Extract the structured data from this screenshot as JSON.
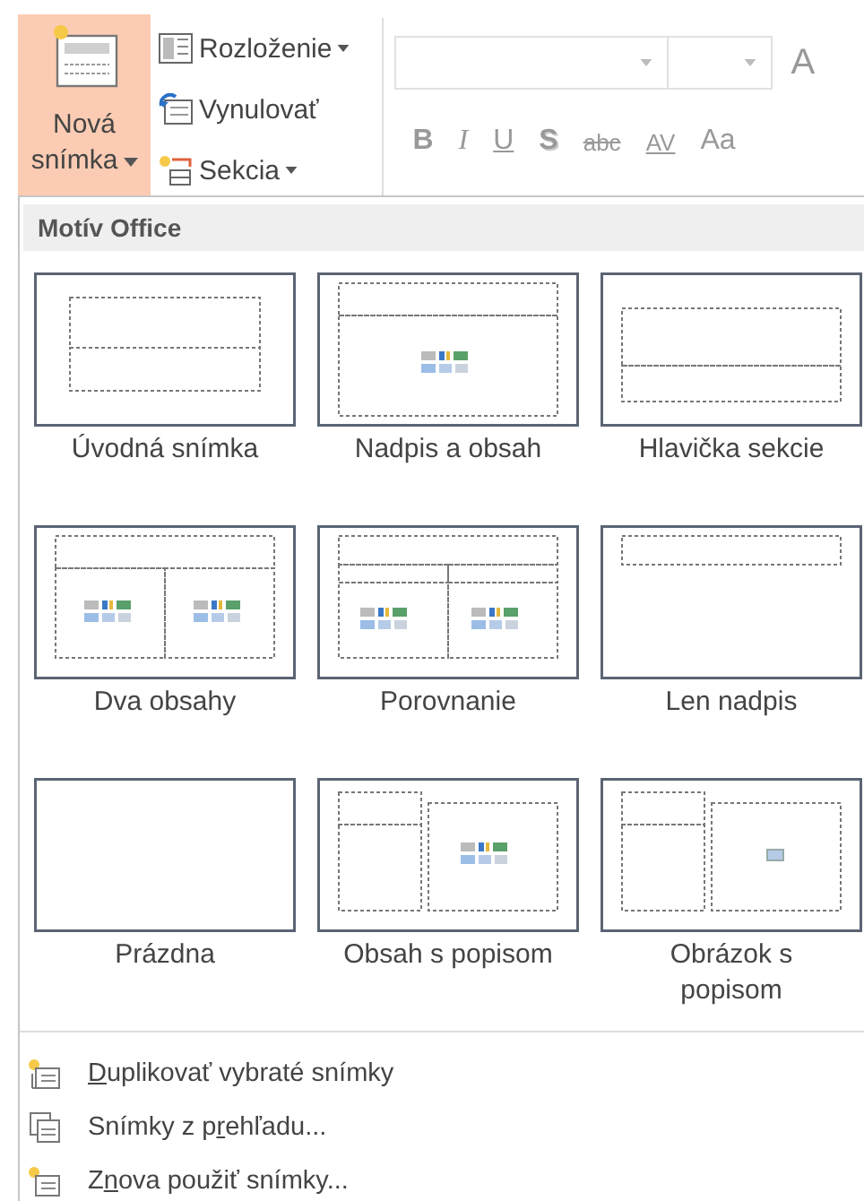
{
  "ribbon": {
    "new_slide": {
      "label": "Nová snímka",
      "active": true
    },
    "slide_commands": [
      {
        "label": "Rozloženie",
        "kind": "layout",
        "dropdown": true
      },
      {
        "label": "Vynulovať",
        "kind": "reset",
        "dropdown": false
      },
      {
        "label": "Sekcia",
        "kind": "section",
        "dropdown": true
      }
    ],
    "font_size_grow": "A",
    "format_buttons": [
      {
        "label": "B",
        "kind": "bold"
      },
      {
        "label": "I",
        "kind": "italic"
      },
      {
        "label": "U",
        "kind": "underline"
      },
      {
        "label": "S",
        "kind": "shadow"
      },
      {
        "label": "abc",
        "kind": "strike"
      },
      {
        "label": "AV",
        "kind": "spacing"
      },
      {
        "label": "Aa",
        "kind": "case"
      }
    ]
  },
  "gallery": {
    "title": "Motív Office",
    "layouts": [
      {
        "label": "Úvodná snímka",
        "kind": "title"
      },
      {
        "label": "Nadpis a obsah",
        "kind": "title-content"
      },
      {
        "label": "Hlavička sekcie",
        "kind": "section-header"
      },
      {
        "label": "Dva obsahy",
        "kind": "two-content"
      },
      {
        "label": "Porovnanie",
        "kind": "comparison"
      },
      {
        "label": "Len nadpis",
        "kind": "title-only"
      },
      {
        "label": "Prázdna",
        "kind": "blank"
      },
      {
        "label": "Obsah s popisom",
        "kind": "content-caption"
      },
      {
        "label": "Obrázok s popisom",
        "kind": "picture-caption"
      }
    ]
  },
  "menu_items": [
    {
      "key": "D",
      "after": "uplikovať vybraté snímky",
      "kind": "duplicate"
    },
    {
      "before": "Snímky z p",
      "key": "r",
      "after": "ehľadu...",
      "kind": "outline"
    },
    {
      "before": "Z",
      "key": "n",
      "after": "ova použiť snímky...",
      "kind": "reuse"
    }
  ]
}
